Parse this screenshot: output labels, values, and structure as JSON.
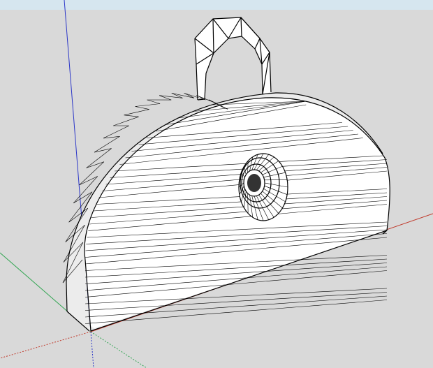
{
  "app": {
    "kind": "3d-modeling-viewport"
  },
  "viewport": {
    "sky_color": "#d6e6ef",
    "ground_color": "#d9d9d9",
    "axes": {
      "red": "#c0392b",
      "green": "#2ea44f",
      "blue": "#2b36c8"
    },
    "model": {
      "fill": "#ffffff",
      "edge": "#000000",
      "shadow_fill": "#ececec"
    }
  },
  "icons": {
    "model": "half-disc-pendant-wireframe-model",
    "hole": "circular-hole",
    "loop": "hanging-loop"
  }
}
